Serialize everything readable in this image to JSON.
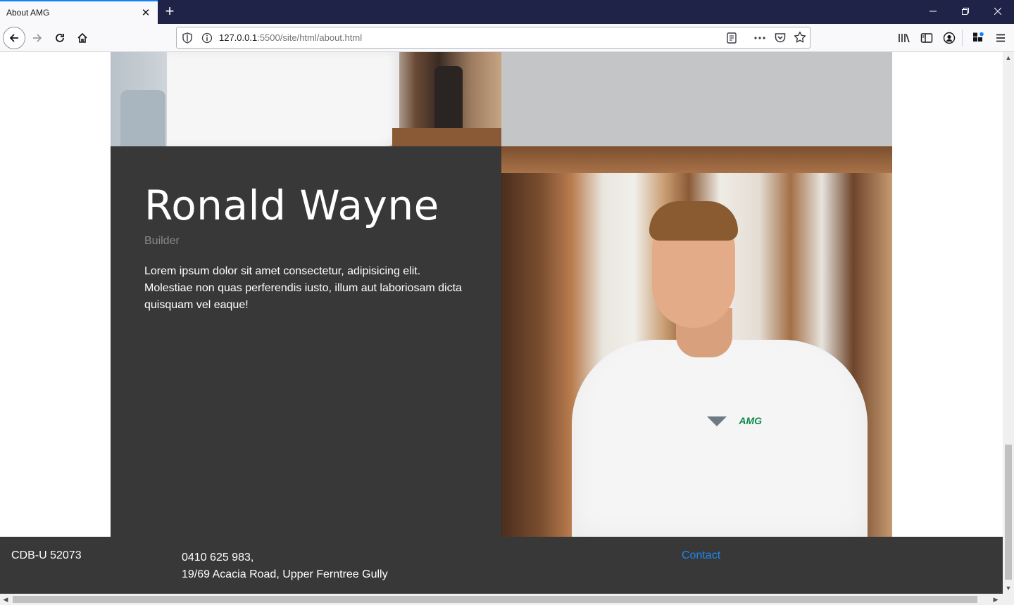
{
  "browser": {
    "tab": {
      "title": "About AMG",
      "close_icon": "close-icon"
    },
    "new_tab_icon": "plus-icon",
    "window": {
      "minimize_icon": "minimize-icon",
      "maximize_icon": "restore-icon",
      "close_icon": "close-icon"
    },
    "nav": {
      "back_icon": "arrow-left-icon",
      "forward_icon": "arrow-right-icon",
      "reload_icon": "reload-icon",
      "home_icon": "home-icon"
    },
    "url": {
      "host": "127.0.0.1",
      "rest": ":5500/site/html/about.html"
    },
    "toolbar_icons": [
      "library-icon",
      "sidebar-icon",
      "account-icon",
      "extensions-icon",
      "menu-icon"
    ],
    "accent": "#0a84ff",
    "tabbar_color": "#1f2348"
  },
  "page": {
    "bio": {
      "name": "Ronald Wayne",
      "role": "Builder",
      "text": "Lorem ipsum dolor sit amet consectetur, adipisicing elit. Molestiae non quas perferendis iusto, illum aut laboriosam dicta quisquam vel eaque!",
      "card_color": "#383838",
      "photo_logo": "AMG"
    },
    "footer": {
      "license": "CDB-U 52073",
      "phone": "0410 625 983,",
      "address": "19/69 Acacia Road, Upper Ferntree Gully",
      "contact_label": "Contact",
      "link_color": "#1e87f0"
    }
  }
}
